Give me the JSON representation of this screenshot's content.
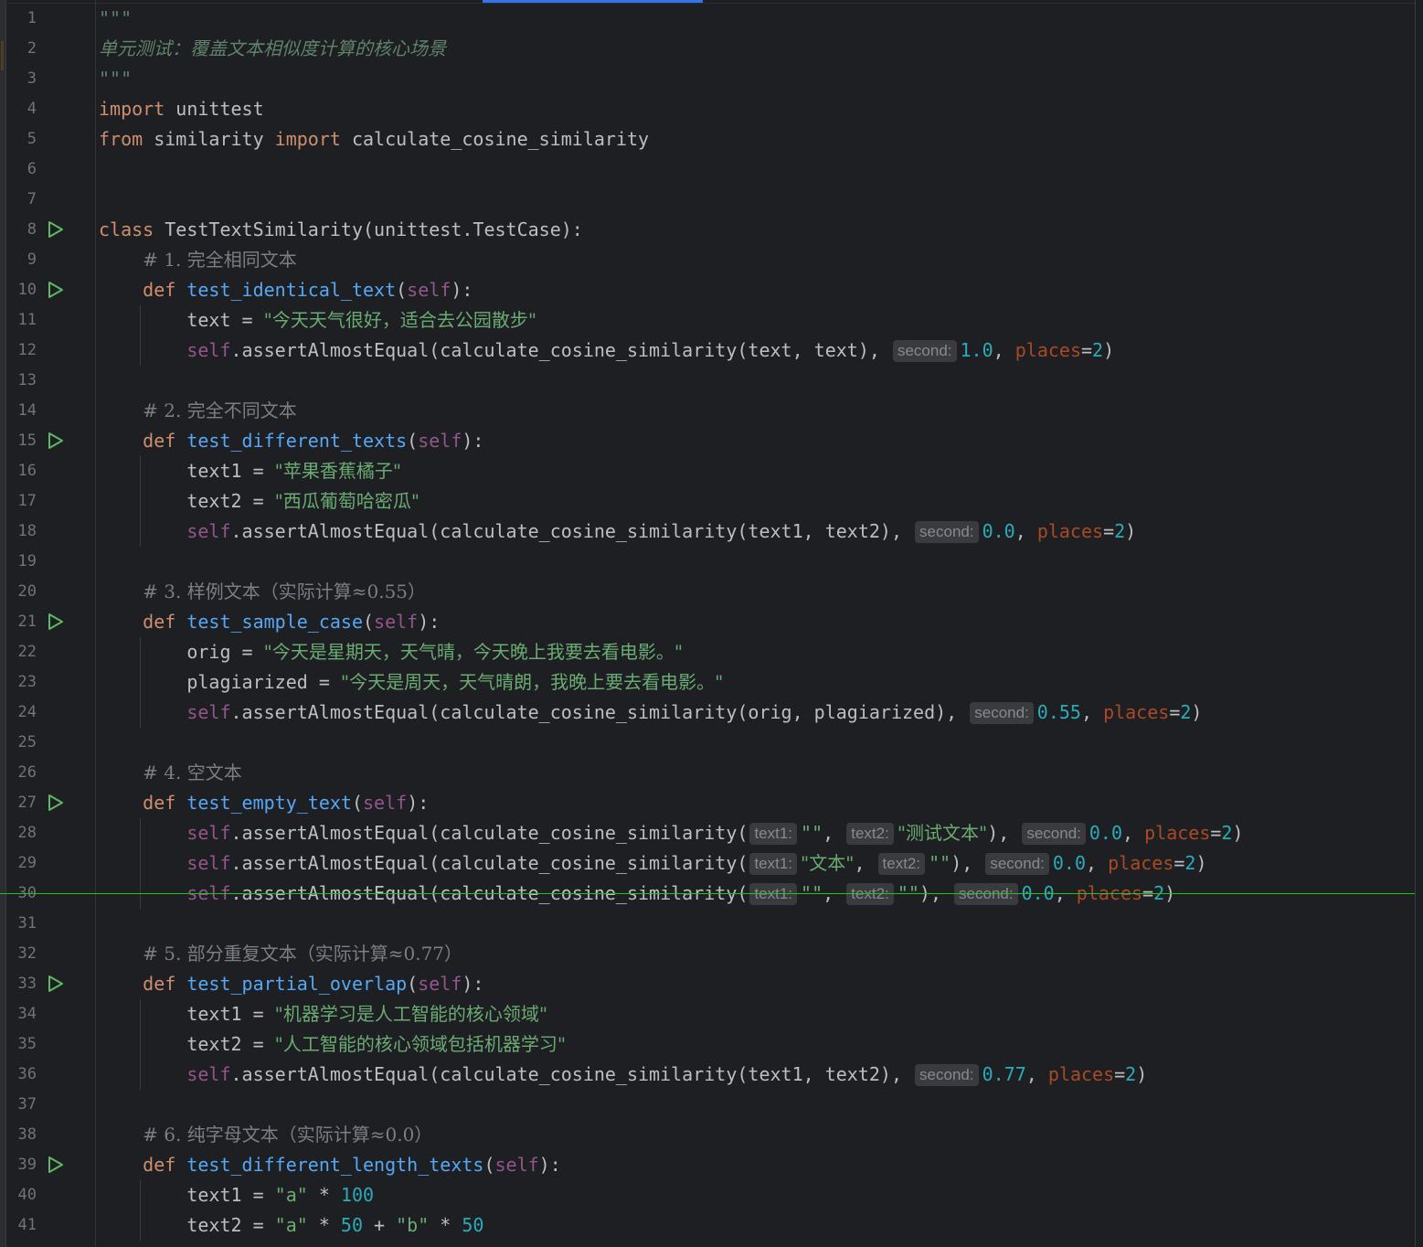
{
  "editor": {
    "lines": [
      {
        "n": "1",
        "run": false,
        "guide": false,
        "t": [
          [
            "doc",
            "\"\"\""
          ]
        ]
      },
      {
        "n": "2",
        "run": false,
        "guide": false,
        "t": [
          [
            "doc",
            "单元测试：覆盖文本相似度计算的核心场景"
          ]
        ]
      },
      {
        "n": "3",
        "run": false,
        "guide": false,
        "t": [
          [
            "doc",
            "\"\"\""
          ]
        ]
      },
      {
        "n": "4",
        "run": false,
        "guide": false,
        "t": [
          [
            "kw",
            "import"
          ],
          [
            "p",
            " unittest"
          ]
        ]
      },
      {
        "n": "5",
        "run": false,
        "guide": false,
        "t": [
          [
            "kw",
            "from"
          ],
          [
            "p",
            " similarity "
          ],
          [
            "kw",
            "import"
          ],
          [
            "p",
            " calculate_cosine_similarity"
          ]
        ]
      },
      {
        "n": "6",
        "run": false,
        "guide": false,
        "t": []
      },
      {
        "n": "7",
        "run": false,
        "guide": false,
        "t": []
      },
      {
        "n": "8",
        "run": true,
        "guide": false,
        "t": [
          [
            "kw",
            "class"
          ],
          [
            "p",
            " TestTextSimilarity(unittest.TestCase):"
          ]
        ]
      },
      {
        "n": "9",
        "run": false,
        "guide": false,
        "t": [
          [
            "p",
            "    "
          ],
          [
            "cm",
            "# 1. 完全相同文本"
          ]
        ]
      },
      {
        "n": "10",
        "run": true,
        "guide": false,
        "t": [
          [
            "p",
            "    "
          ],
          [
            "kw",
            "def"
          ],
          [
            "p",
            " "
          ],
          [
            "fn",
            "test_identical_text"
          ],
          [
            "p",
            "("
          ],
          [
            "self",
            "self"
          ],
          [
            "p",
            "):"
          ]
        ]
      },
      {
        "n": "11",
        "run": false,
        "guide": true,
        "t": [
          [
            "p",
            "        text = "
          ],
          [
            "str",
            "\"今天天气很好，适合去公园散步\""
          ]
        ]
      },
      {
        "n": "12",
        "run": false,
        "guide": true,
        "t": [
          [
            "p",
            "        "
          ],
          [
            "self",
            "self"
          ],
          [
            "p",
            ".assertAlmostEqual(calculate_cosine_similarity(text, text), "
          ],
          [
            "hint",
            "second:"
          ],
          [
            "num",
            "1.0"
          ],
          [
            "p",
            ", "
          ],
          [
            "param",
            "places"
          ],
          [
            "p",
            "="
          ],
          [
            "num",
            "2"
          ],
          [
            "p",
            ")"
          ]
        ]
      },
      {
        "n": "13",
        "run": false,
        "guide": false,
        "t": []
      },
      {
        "n": "14",
        "run": false,
        "guide": false,
        "t": [
          [
            "p",
            "    "
          ],
          [
            "cm",
            "# 2. 完全不同文本"
          ]
        ]
      },
      {
        "n": "15",
        "run": true,
        "guide": false,
        "t": [
          [
            "p",
            "    "
          ],
          [
            "kw",
            "def"
          ],
          [
            "p",
            " "
          ],
          [
            "fn",
            "test_different_texts"
          ],
          [
            "p",
            "("
          ],
          [
            "self",
            "self"
          ],
          [
            "p",
            "):"
          ]
        ]
      },
      {
        "n": "16",
        "run": false,
        "guide": true,
        "t": [
          [
            "p",
            "        text1 = "
          ],
          [
            "str",
            "\"苹果香蕉橘子\""
          ]
        ]
      },
      {
        "n": "17",
        "run": false,
        "guide": true,
        "t": [
          [
            "p",
            "        text2 = "
          ],
          [
            "str",
            "\"西瓜葡萄哈密瓜\""
          ]
        ]
      },
      {
        "n": "18",
        "run": false,
        "guide": true,
        "t": [
          [
            "p",
            "        "
          ],
          [
            "self",
            "self"
          ],
          [
            "p",
            ".assertAlmostEqual(calculate_cosine_similarity(text1, text2), "
          ],
          [
            "hint",
            "second:"
          ],
          [
            "num",
            "0.0"
          ],
          [
            "p",
            ", "
          ],
          [
            "param",
            "places"
          ],
          [
            "p",
            "="
          ],
          [
            "num",
            "2"
          ],
          [
            "p",
            ")"
          ]
        ]
      },
      {
        "n": "19",
        "run": false,
        "guide": false,
        "t": []
      },
      {
        "n": "20",
        "run": false,
        "guide": false,
        "t": [
          [
            "p",
            "    "
          ],
          [
            "cm",
            "# 3. 样例文本（实际计算≈0.55）"
          ]
        ]
      },
      {
        "n": "21",
        "run": true,
        "guide": false,
        "t": [
          [
            "p",
            "    "
          ],
          [
            "kw",
            "def"
          ],
          [
            "p",
            " "
          ],
          [
            "fn",
            "test_sample_case"
          ],
          [
            "p",
            "("
          ],
          [
            "self",
            "self"
          ],
          [
            "p",
            "):"
          ]
        ]
      },
      {
        "n": "22",
        "run": false,
        "guide": true,
        "t": [
          [
            "p",
            "        orig = "
          ],
          [
            "str",
            "\"今天是星期天，天气晴，今天晚上我要去看电影。\""
          ]
        ]
      },
      {
        "n": "23",
        "run": false,
        "guide": true,
        "t": [
          [
            "p",
            "        plagiarized = "
          ],
          [
            "str",
            "\"今天是周天，天气晴朗，我晚上要去看电影。\""
          ]
        ]
      },
      {
        "n": "24",
        "run": false,
        "guide": true,
        "t": [
          [
            "p",
            "        "
          ],
          [
            "self",
            "self"
          ],
          [
            "p",
            ".assertAlmostEqual(calculate_cosine_similarity(orig, plagiarized), "
          ],
          [
            "hint",
            "second:"
          ],
          [
            "num",
            "0.55"
          ],
          [
            "p",
            ", "
          ],
          [
            "param",
            "places"
          ],
          [
            "p",
            "="
          ],
          [
            "num",
            "2"
          ],
          [
            "p",
            ")"
          ]
        ]
      },
      {
        "n": "25",
        "run": false,
        "guide": false,
        "t": []
      },
      {
        "n": "26",
        "run": false,
        "guide": false,
        "t": [
          [
            "p",
            "    "
          ],
          [
            "cm",
            "# 4. 空文本"
          ]
        ]
      },
      {
        "n": "27",
        "run": true,
        "guide": false,
        "t": [
          [
            "p",
            "    "
          ],
          [
            "kw",
            "def"
          ],
          [
            "p",
            " "
          ],
          [
            "fn",
            "test_empty_text"
          ],
          [
            "p",
            "("
          ],
          [
            "self",
            "self"
          ],
          [
            "p",
            "):"
          ]
        ]
      },
      {
        "n": "28",
        "run": false,
        "guide": true,
        "t": [
          [
            "p",
            "        "
          ],
          [
            "self",
            "self"
          ],
          [
            "p",
            ".assertAlmostEqual(calculate_cosine_similarity("
          ],
          [
            "hint",
            "text1:"
          ],
          [
            "str",
            "\"\""
          ],
          [
            "p",
            ", "
          ],
          [
            "hint",
            "text2:"
          ],
          [
            "str",
            "\"测试文本\""
          ],
          [
            "p",
            "), "
          ],
          [
            "hint",
            "second:"
          ],
          [
            "num",
            "0.0"
          ],
          [
            "p",
            ", "
          ],
          [
            "param",
            "places"
          ],
          [
            "p",
            "="
          ],
          [
            "num",
            "2"
          ],
          [
            "p",
            ")"
          ]
        ]
      },
      {
        "n": "29",
        "run": false,
        "guide": true,
        "t": [
          [
            "p",
            "        "
          ],
          [
            "self",
            "self"
          ],
          [
            "p",
            ".assertAlmostEqual(calculate_cosine_similarity("
          ],
          [
            "hint",
            "text1:"
          ],
          [
            "str",
            "\"文本\""
          ],
          [
            "p",
            ", "
          ],
          [
            "hint",
            "text2:"
          ],
          [
            "str",
            "\"\""
          ],
          [
            "p",
            "), "
          ],
          [
            "hint",
            "second:"
          ],
          [
            "num",
            "0.0"
          ],
          [
            "p",
            ", "
          ],
          [
            "param",
            "places"
          ],
          [
            "p",
            "="
          ],
          [
            "num",
            "2"
          ],
          [
            "p",
            ")"
          ]
        ]
      },
      {
        "n": "30",
        "run": false,
        "guide": true,
        "t": [
          [
            "p",
            "        "
          ],
          [
            "self",
            "self"
          ],
          [
            "p",
            ".assertAlmostEqual(calculate_cosine_similarity("
          ],
          [
            "hint",
            "text1:"
          ],
          [
            "str",
            "\"\""
          ],
          [
            "p",
            ", "
          ],
          [
            "hint",
            "text2:"
          ],
          [
            "str",
            "\"\""
          ],
          [
            "p",
            "), "
          ],
          [
            "hint",
            "second:"
          ],
          [
            "num",
            "0.0"
          ],
          [
            "p",
            ", "
          ],
          [
            "param",
            "places"
          ],
          [
            "p",
            "="
          ],
          [
            "num",
            "2"
          ],
          [
            "p",
            ")"
          ]
        ]
      },
      {
        "n": "31",
        "run": false,
        "guide": false,
        "t": []
      },
      {
        "n": "32",
        "run": false,
        "guide": false,
        "t": [
          [
            "p",
            "    "
          ],
          [
            "cm",
            "# 5. 部分重复文本（实际计算≈0.77）"
          ]
        ]
      },
      {
        "n": "33",
        "run": true,
        "guide": false,
        "t": [
          [
            "p",
            "    "
          ],
          [
            "kw",
            "def"
          ],
          [
            "p",
            " "
          ],
          [
            "fn",
            "test_partial_overlap"
          ],
          [
            "p",
            "("
          ],
          [
            "self",
            "self"
          ],
          [
            "p",
            "):"
          ]
        ]
      },
      {
        "n": "34",
        "run": false,
        "guide": true,
        "t": [
          [
            "p",
            "        text1 = "
          ],
          [
            "str",
            "\"机器学习是人工智能的核心领域\""
          ]
        ]
      },
      {
        "n": "35",
        "run": false,
        "guide": true,
        "t": [
          [
            "p",
            "        text2 = "
          ],
          [
            "str",
            "\"人工智能的核心领域包括机器学习\""
          ]
        ]
      },
      {
        "n": "36",
        "run": false,
        "guide": true,
        "t": [
          [
            "p",
            "        "
          ],
          [
            "self",
            "self"
          ],
          [
            "p",
            ".assertAlmostEqual(calculate_cosine_similarity(text1, text2), "
          ],
          [
            "hint",
            "second:"
          ],
          [
            "num",
            "0.77"
          ],
          [
            "p",
            ", "
          ],
          [
            "param",
            "places"
          ],
          [
            "p",
            "="
          ],
          [
            "num",
            "2"
          ],
          [
            "p",
            ")"
          ]
        ]
      },
      {
        "n": "37",
        "run": false,
        "guide": false,
        "t": []
      },
      {
        "n": "38",
        "run": false,
        "guide": false,
        "t": [
          [
            "p",
            "    "
          ],
          [
            "cm",
            "# 6. 纯字母文本（实际计算≈0.0）"
          ]
        ]
      },
      {
        "n": "39",
        "run": true,
        "guide": false,
        "t": [
          [
            "p",
            "    "
          ],
          [
            "kw",
            "def"
          ],
          [
            "p",
            " "
          ],
          [
            "fn",
            "test_different_length_texts"
          ],
          [
            "p",
            "("
          ],
          [
            "self",
            "self"
          ],
          [
            "p",
            "):"
          ]
        ]
      },
      {
        "n": "40",
        "run": false,
        "guide": true,
        "t": [
          [
            "p",
            "        text1 = "
          ],
          [
            "str",
            "\"a\""
          ],
          [
            "p",
            " * "
          ],
          [
            "num",
            "100"
          ]
        ]
      },
      {
        "n": "41",
        "run": false,
        "guide": true,
        "t": [
          [
            "p",
            "        text2 = "
          ],
          [
            "str",
            "\"a\""
          ],
          [
            "p",
            " * "
          ],
          [
            "num",
            "50"
          ],
          [
            "p",
            " + "
          ],
          [
            "str",
            "\"b\""
          ],
          [
            "p",
            " * "
          ],
          [
            "num",
            "50"
          ]
        ]
      }
    ],
    "colors": {
      "background": "#1e1f22",
      "keyword": "#cf8e6d",
      "function": "#56a8f5",
      "self": "#94558d",
      "string": "#6aab73",
      "number": "#2aacb8",
      "comment": "#7a7e85",
      "run_icon": "#5fb865",
      "tab_accent": "#3574f0"
    },
    "icons": {
      "run": "run-gutter-icon"
    }
  }
}
